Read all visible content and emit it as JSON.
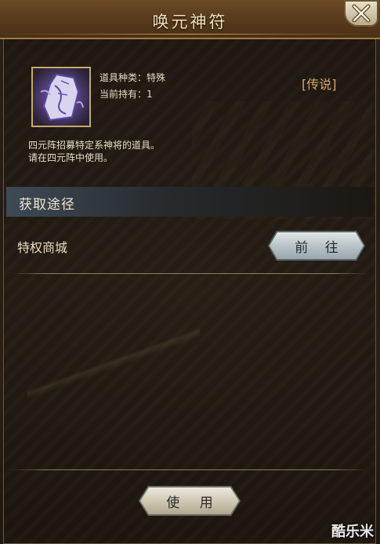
{
  "window": {
    "title": "唤元神符"
  },
  "item": {
    "icon": "talisman-scroll-icon",
    "type_line": "道具种类：特殊",
    "owned_line": "当前持有：1",
    "rarity": "[传说]",
    "description_line1": "四元阵招募特定系神将的道具。",
    "description_line2": "请在四元阵中使用。"
  },
  "acquire": {
    "header": "获取途径",
    "sources": [
      {
        "label": "特权商城",
        "button": "前 往"
      }
    ]
  },
  "footer": {
    "use_button": "使 用"
  },
  "watermark": "酷乐米",
  "colors": {
    "title_text": "#f3e2b8",
    "rarity": "#d6a66a",
    "body_text": "#e8dcc2",
    "header_bar": "#3e4a56"
  }
}
